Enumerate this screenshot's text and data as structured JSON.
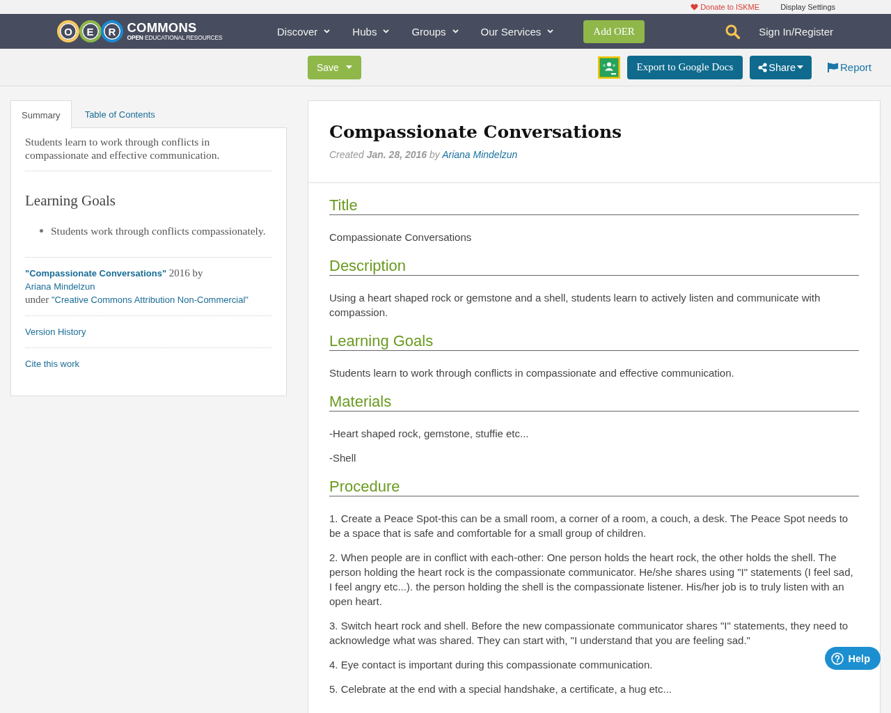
{
  "top_bar": {
    "links": [
      {
        "kind": "donate",
        "label": "Donate to ISKME"
      },
      {
        "kind": "plain",
        "label": "Display Settings"
      }
    ]
  },
  "nav": {
    "logo": {
      "letters": [
        {
          "char": "O",
          "color": "#f6c85f"
        },
        {
          "char": "E",
          "color": "#8cb848"
        },
        {
          "char": "R",
          "color": "#1b88d2"
        }
      ],
      "wordmark": "COMMONS",
      "tagline": "**OPEN** EDUCATIONAL RESOURCES"
    },
    "menu": [
      {
        "label": "Discover"
      },
      {
        "label": "Hubs"
      },
      {
        "label": "Groups"
      },
      {
        "label": "Our Services"
      }
    ],
    "add_button": "Add OER",
    "sign_in": "Sign In/Register"
  },
  "toolbar": {
    "save": "Save",
    "export": "Export to Google Docs",
    "share": "Share",
    "report": "Report"
  },
  "sidebar": {
    "tabs": [
      {
        "label": "Summary",
        "selected": true
      },
      {
        "label": "Table of Contents",
        "selected": false
      }
    ],
    "summary": "Students learn to work through conflicts in compassionate and effective communication.",
    "goals_heading": "Learning Goals",
    "goals": [
      "Students work through conflicts compassionately."
    ],
    "attribution": {
      "title": "\"Compassionate Conversations\"",
      "year_by": "2016 by",
      "author": "Ariana Mindelzun",
      "under": "under",
      "license": "\"Creative Commons Attribution Non-Commercial\""
    },
    "links": [
      "Version History",
      "Cite this work"
    ]
  },
  "resource": {
    "title": "Compassionate Conversations",
    "meta": "Created **Jan. 28, 2016** by",
    "author": "Ariana Mindelzun",
    "sections": [
      {
        "heading": "Title",
        "paragraphs": [
          "Compassionate Conversations"
        ]
      },
      {
        "heading": "Description",
        "paragraphs": [
          "Using a heart shaped rock or gemstone and a shell, students learn to actively listen and communicate with compassion."
        ]
      },
      {
        "heading": "Learning Goals",
        "paragraphs": [
          "Students learn to work through conflicts in compassionate and effective communication."
        ]
      },
      {
        "heading": "Materials",
        "paragraphs": [
          "-Heart shaped rock, gemstone, stuffie etc...",
          "-Shell"
        ]
      },
      {
        "heading": "Procedure",
        "paragraphs": [
          "1. Create a Peace Spot-this can be a small room, a corner of a room, a couch, a desk. The Peace Spot needs to be a space that is safe and comfortable for a small group of children.",
          "2. When people are in conflict with each-other: One person holds the heart rock, the other holds the shell. The person holding the heart rock is the compassionate communicator. He/she shares using \"I\" statements (I feel sad, I feel angry etc...). the person holding the shell is the compassionate listener. His/her job is to truly listen with an open heart.",
          "3. Switch heart rock and shell. Before the new compassionate communicator shares \"I\" statements, they need to acknowledge what was shared. They can start with, \"I understand that you are feeling sad.\"",
          "4. Eye contact is important during this compassionate communication.",
          "5. Celebrate at the end with a special handshake, a certificate, a hug etc..."
        ]
      }
    ]
  },
  "help": {
    "label": "Help"
  }
}
